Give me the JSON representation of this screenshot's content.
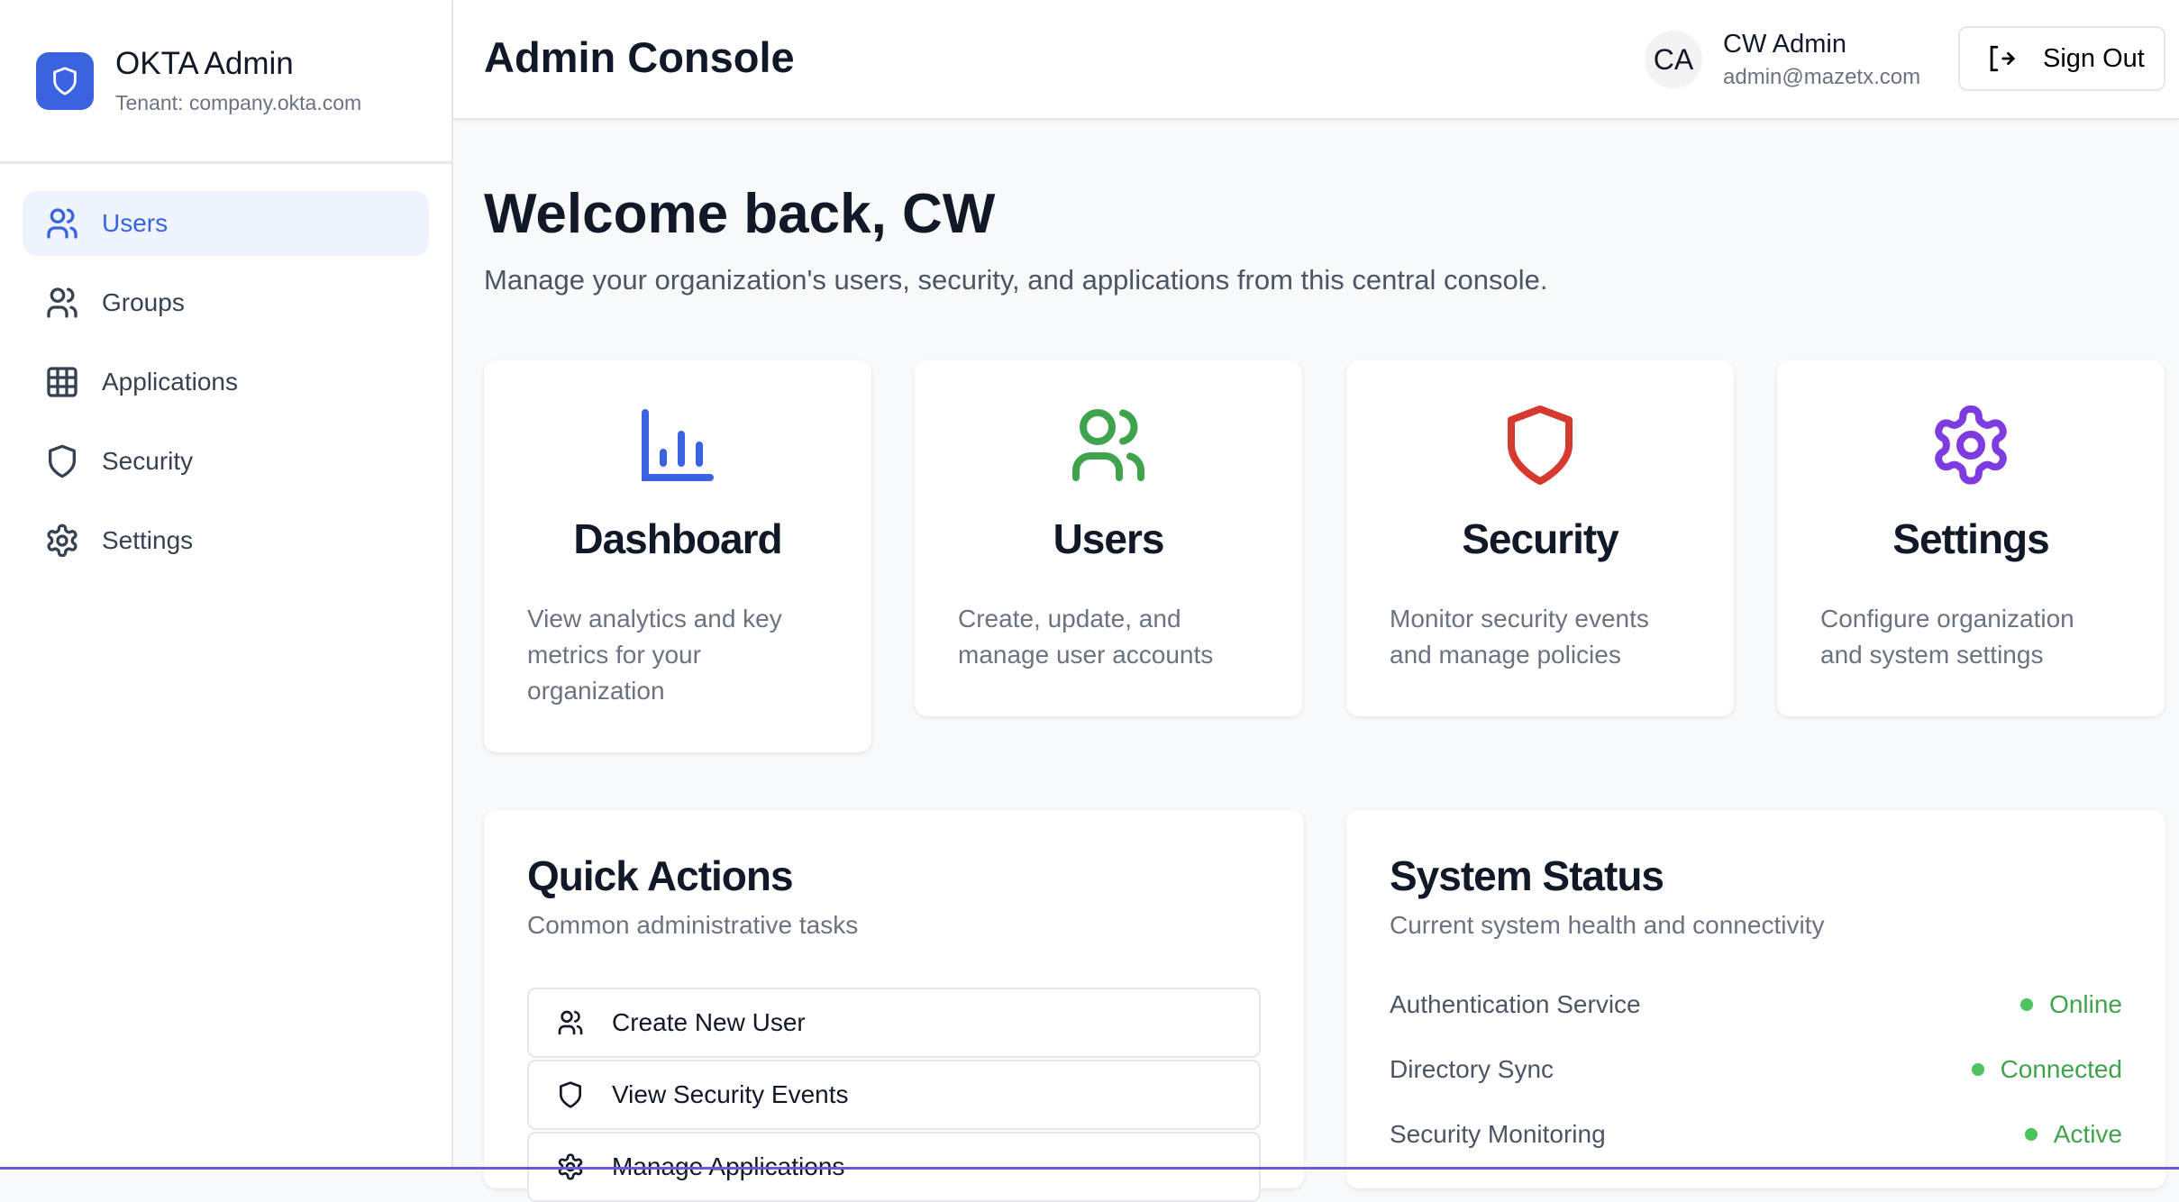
{
  "sidebar": {
    "brand_title": "OKTA Admin",
    "tenant": "Tenant: company.okta.com",
    "items": [
      {
        "label": "Users",
        "icon": "users-icon",
        "active": true
      },
      {
        "label": "Groups",
        "icon": "groups-icon"
      },
      {
        "label": "Applications",
        "icon": "grid-icon"
      },
      {
        "label": "Security",
        "icon": "shield-icon"
      },
      {
        "label": "Settings",
        "icon": "gear-icon"
      }
    ]
  },
  "header": {
    "title": "Admin Console",
    "avatar_initials": "CA",
    "user_name": "CW Admin",
    "user_email": "admin@mazetx.com",
    "sign_out": "Sign Out"
  },
  "welcome": {
    "title": "Welcome back, CW",
    "subtitle": "Manage your organization's users, security, and applications from this central console."
  },
  "cards": [
    {
      "title": "Dashboard",
      "desc": "View analytics and key metrics for your organization",
      "icon": "bar-chart-icon",
      "color": "#3b63e0"
    },
    {
      "title": "Users",
      "desc": "Create, update, and manage user accounts",
      "icon": "users-icon",
      "color": "#3fa34d"
    },
    {
      "title": "Security",
      "desc": "Monitor security events and manage policies",
      "icon": "shield-icon",
      "color": "#d63a2f"
    },
    {
      "title": "Settings",
      "desc": "Configure organization and system settings",
      "icon": "gear-icon",
      "color": "#7e3ce0"
    }
  ],
  "quick_actions": {
    "title": "Quick Actions",
    "subtitle": "Common administrative tasks",
    "items": [
      "Create New User",
      "View Security Events",
      "Manage Applications"
    ]
  },
  "system_status": {
    "title": "System Status",
    "subtitle": "Current system health and connectivity",
    "rows": [
      {
        "label": "Authentication Service",
        "value": "Online"
      },
      {
        "label": "Directory Sync",
        "value": "Connected"
      },
      {
        "label": "Security Monitoring",
        "value": "Active"
      }
    ],
    "status_color": "#3fa34d"
  }
}
